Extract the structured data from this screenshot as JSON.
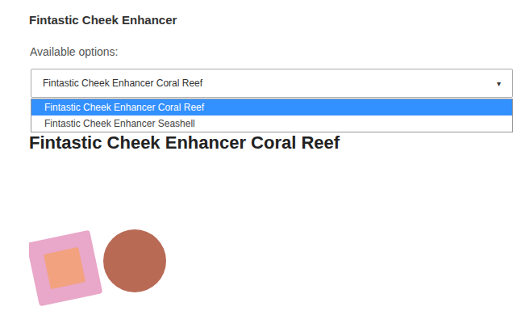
{
  "product": {
    "title": "Fintastic Cheek Enhancer"
  },
  "options_label": "Available options:",
  "select": {
    "value": "Fintastic Cheek Enhancer Coral Reef",
    "arrow": "▾",
    "expanded": true
  },
  "options": [
    {
      "label": "Fintastic Cheek Enhancer Coral Reef",
      "selected": true
    },
    {
      "label": "Fintastic Cheek Enhancer Seashell",
      "selected": false
    }
  ],
  "heading": "Fintastic Cheek Enhancer Coral Reef"
}
